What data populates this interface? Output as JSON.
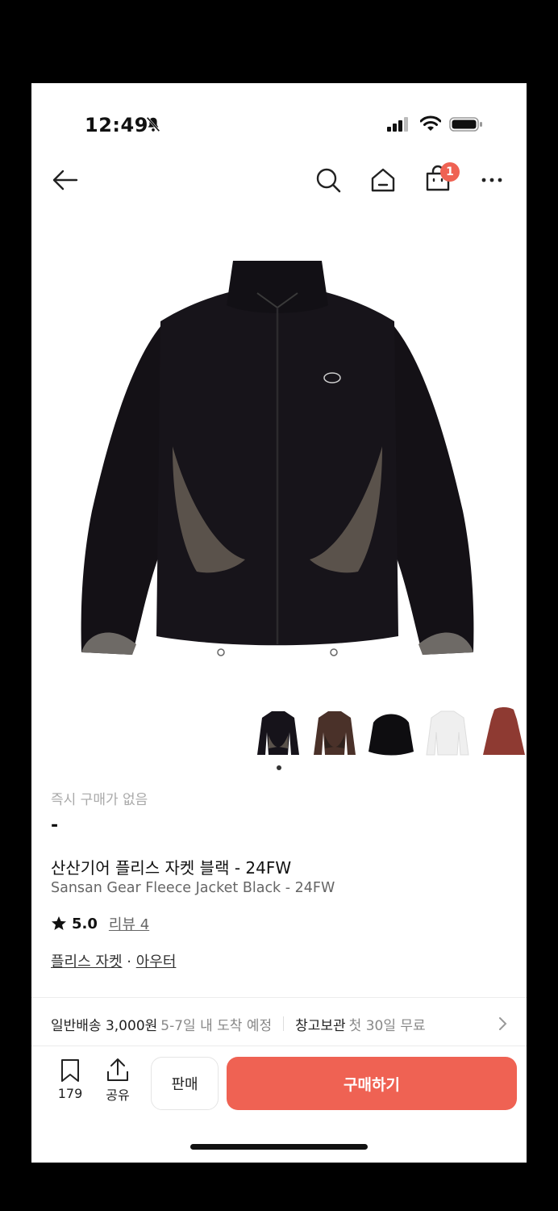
{
  "status_bar": {
    "time": "12:49"
  },
  "nav": {
    "cart_badge": "1"
  },
  "product": {
    "thumbnail_count": 5,
    "no_instant_purchase": "즉시 구매가 없음",
    "price": "-",
    "title_ko": "산산기어 플리스 자켓 블랙 - 24FW",
    "title_en": "Sansan Gear Fleece Jacket Black - 24FW",
    "rating": "5.0",
    "review_label": "리뷰 4",
    "category_main": "플리스 자켓",
    "category_sep": "·",
    "category_sub": "아우터"
  },
  "shipping": {
    "standard_label": "일반배송 3,000원",
    "standard_eta": "5-7일 내 도착 예정",
    "storage_label": "창고보관",
    "storage_promo": "첫 30일 무료"
  },
  "actions": {
    "bookmark_count": "179",
    "share_label": "공유",
    "sell_label": "판매",
    "buy_label": "구매하기"
  },
  "colors": {
    "accent": "#ef6253",
    "badge": "#ef6253"
  }
}
